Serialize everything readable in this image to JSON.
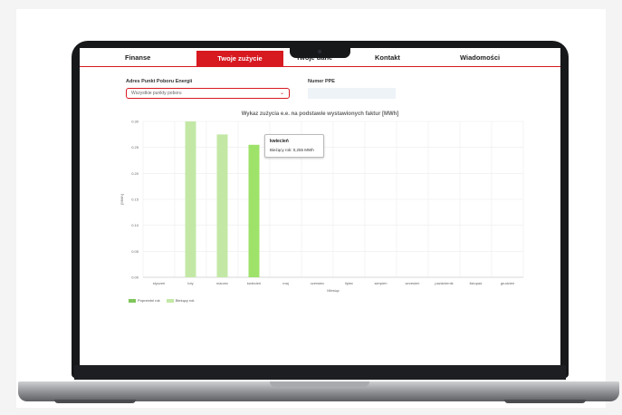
{
  "nav": {
    "tabs": [
      {
        "label": "Finanse",
        "active": false
      },
      {
        "label": "Twoje zużycie",
        "active": true
      },
      {
        "label": "Twoje dane",
        "active": false
      },
      {
        "label": "Kontakt",
        "active": false
      },
      {
        "label": "Wiadomości",
        "active": false
      }
    ]
  },
  "filters": {
    "address_label": "Adres Punkt Poboru Energii",
    "address_value": "Wszystkie punkty poboru",
    "ppe_label": "Numer PPE",
    "ppe_value": ""
  },
  "chart_data": {
    "type": "bar",
    "title": "Wykaz zużycia e.e. na podstawie wystawionych faktur [MWh]",
    "xlabel": "Miesiąc",
    "ylabel": "[MWh]",
    "categories": [
      "styczeń",
      "luty",
      "marzec",
      "kwiecień",
      "maj",
      "czerwiec",
      "lipiec",
      "sierpień",
      "wrzesień",
      "październik",
      "listopad",
      "grudzień"
    ],
    "ylim": [
      0,
      0.3
    ],
    "yticks": [
      "0.00",
      "0.05",
      "0.10",
      "0.15",
      "0.20",
      "0.25",
      "0.30"
    ],
    "series": [
      {
        "name": "Poprzedni rok",
        "color": "#7fc65a",
        "values": [
          null,
          null,
          null,
          null,
          null,
          null,
          null,
          null,
          null,
          null,
          null,
          null
        ]
      },
      {
        "name": "Bieżący rok",
        "color": "#c3e8a6",
        "values": [
          null,
          0.3,
          0.275,
          0.255,
          null,
          null,
          null,
          null,
          null,
          null,
          null,
          null
        ]
      }
    ],
    "highlight_index": 3,
    "highlight_color": "#9ee26a",
    "grid": true,
    "legend_position": "bottom-left",
    "tooltip": {
      "title": "kwiecień",
      "text": "Bieżący rok: 0,255 MWh"
    }
  }
}
